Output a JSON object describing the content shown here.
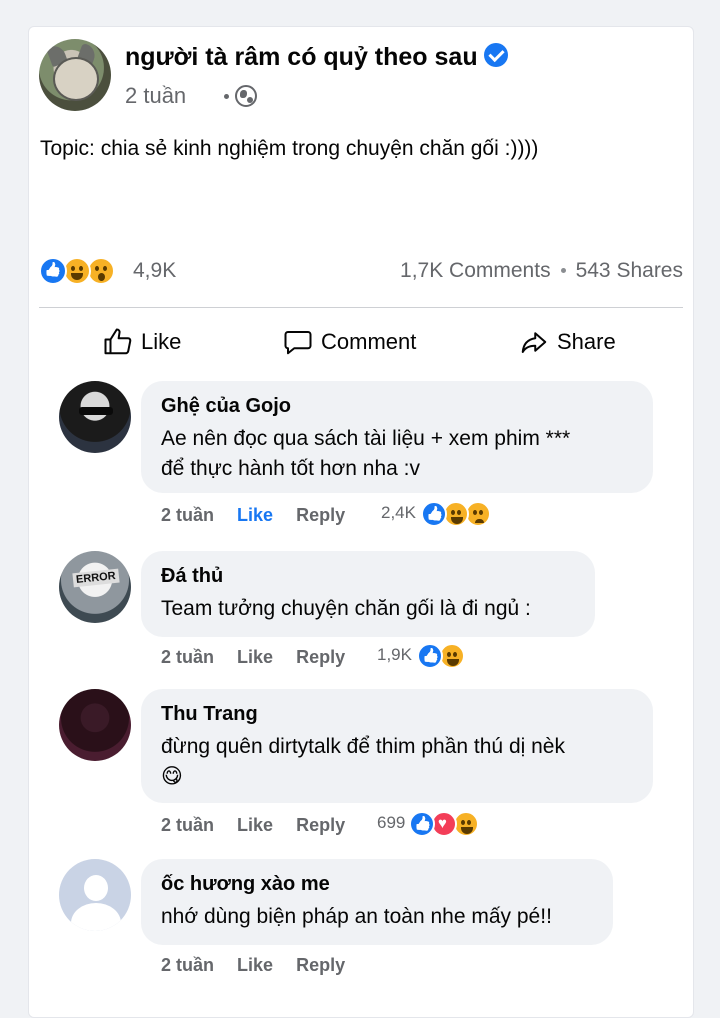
{
  "post": {
    "page_name": "người tà râm có quỷ theo sau",
    "time": "2 tuần",
    "text": "Topic: chia sẻ kinh nghiệm trong chuyện chăn gối :))))",
    "reactions_count": "4,9K",
    "comments_count": "1,7K Comments",
    "shares_count": "543 Shares",
    "reaction_icons": [
      "like-icon",
      "haha-icon",
      "wow-icon"
    ]
  },
  "actions": {
    "like": "Like",
    "comment": "Comment",
    "share": "Share"
  },
  "comments": [
    {
      "name": "Ghệ của Gojo",
      "lines": [
        "Ae nên đọc qua sách tài liệu + xem phim ***",
        "để thực hành tốt hơn nha :v"
      ],
      "time": "2 tuần",
      "like": "Like",
      "liked": true,
      "reply": "Reply",
      "reactions": "2,4K",
      "reaction_icons": [
        "like-icon",
        "haha-icon",
        "sad-icon"
      ]
    },
    {
      "name": "Đá thủ",
      "lines": [
        "Team tưởng chuyện chăn gối là đi ngủ :"
      ],
      "time": "2 tuần",
      "like": "Like",
      "liked": false,
      "reply": "Reply",
      "reactions": "1,9K",
      "reaction_icons": [
        "like-icon",
        "haha-icon"
      ]
    },
    {
      "name": "Thu Trang",
      "lines": [
        "đừng quên dirtytalk để thim phần thú dị nèk",
        "😋"
      ],
      "time": "2 tuần",
      "like": "Like",
      "liked": false,
      "reply": "Reply",
      "reactions": "699",
      "reaction_icons": [
        "like-icon",
        "love-icon",
        "haha-icon"
      ]
    },
    {
      "name": "ốc hương xào me",
      "lines": [
        "nhớ dùng biện pháp an toàn nhe mấy pé!!"
      ],
      "time": "2 tuần",
      "like": "Like",
      "liked": false,
      "reply": "Reply",
      "reactions": "",
      "reaction_icons": []
    }
  ],
  "colors": {
    "accent": "#1877f2",
    "bubble": "#f0f2f5",
    "muted_text": "#65676b"
  }
}
